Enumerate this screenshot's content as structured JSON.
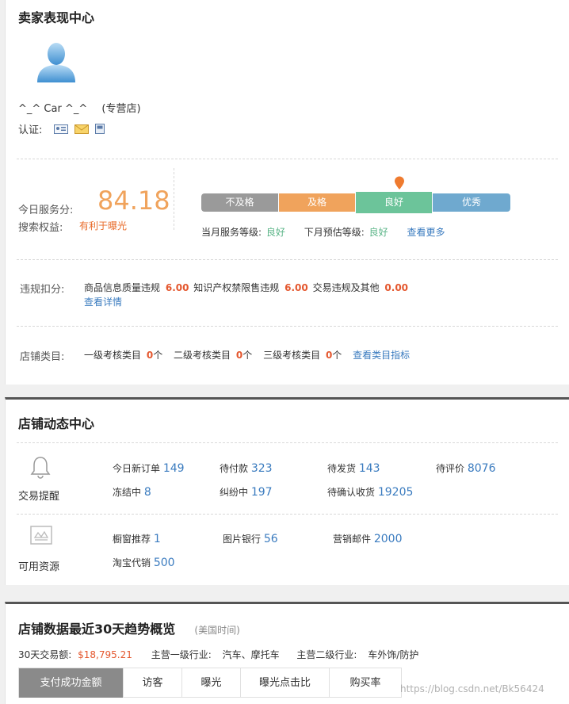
{
  "seller": {
    "title": "卖家表现中心",
    "name": "^_^ Car ^_^",
    "shop_type": "(专营店)",
    "cert_label": "认证:",
    "service_score_label": "今日服务分:",
    "service_score": "84.18",
    "rights_label": "搜索权益:",
    "rights_value": "有利于曝光",
    "levels": [
      "不及格",
      "及格",
      "良好",
      "优秀"
    ],
    "level_colors": [
      "#9a9a9a",
      "#f0a35c",
      "#6cc49a",
      "#6fa9cf"
    ],
    "current_level_index": 2,
    "current_level_label": "当月服务等级:",
    "current_level": "良好",
    "next_level_label": "下月预估等级:",
    "next_level": "良好",
    "see_more": "查看更多",
    "violation": {
      "label": "违规扣分:",
      "item1_label": "商品信息质量违规",
      "item1_value": "6.00",
      "item2_label": "知识产权禁限售违规",
      "item2_value": "6.00",
      "item3_label": "交易违规及其他",
      "item3_value": "0.00",
      "detail_link": "查看详情"
    },
    "category": {
      "label": "店铺类目:",
      "c1_label": "一级考核类目",
      "c1_value": "0",
      "c2_label": "二级考核类目",
      "c2_value": "0",
      "c3_label": "三级考核类目",
      "c3_value": "0",
      "unit": "个",
      "link": "查看类目指标"
    }
  },
  "dynamics": {
    "title": "店铺动态中心",
    "trade": {
      "label": "交易提醒",
      "items": [
        {
          "label": "今日新订单",
          "value": "149"
        },
        {
          "label": "待付款",
          "value": "323"
        },
        {
          "label": "待发货",
          "value": "143"
        },
        {
          "label": "待评价",
          "value": "8076"
        },
        {
          "label": "冻结中",
          "value": "8"
        },
        {
          "label": "纠纷中",
          "value": "197"
        },
        {
          "label": "待确认收货",
          "value": "19205"
        }
      ]
    },
    "resources": {
      "label": "可用资源",
      "items": [
        {
          "label": "橱窗推荐",
          "value": "1"
        },
        {
          "label": "图片银行",
          "value": "56"
        },
        {
          "label": "营销邮件",
          "value": "2000"
        },
        {
          "label": "淘宝代销",
          "value": "500"
        }
      ]
    }
  },
  "trend": {
    "title": "店铺数据最近30天趋势概览",
    "timezone": "(美国时间)",
    "trade_amount_label": "30天交易额:",
    "trade_amount": "$18,795.21",
    "industry1_label": "主营一级行业:",
    "industry1": "汽车、摩托车",
    "industry2_label": "主营二级行业:",
    "industry2": "车外饰/防护",
    "tabs": [
      "支付成功金额",
      "访客",
      "曝光",
      "曝光点击比",
      "购买率"
    ],
    "active_tab": 0
  },
  "watermark": "https://blog.csdn.net/Bk56424"
}
